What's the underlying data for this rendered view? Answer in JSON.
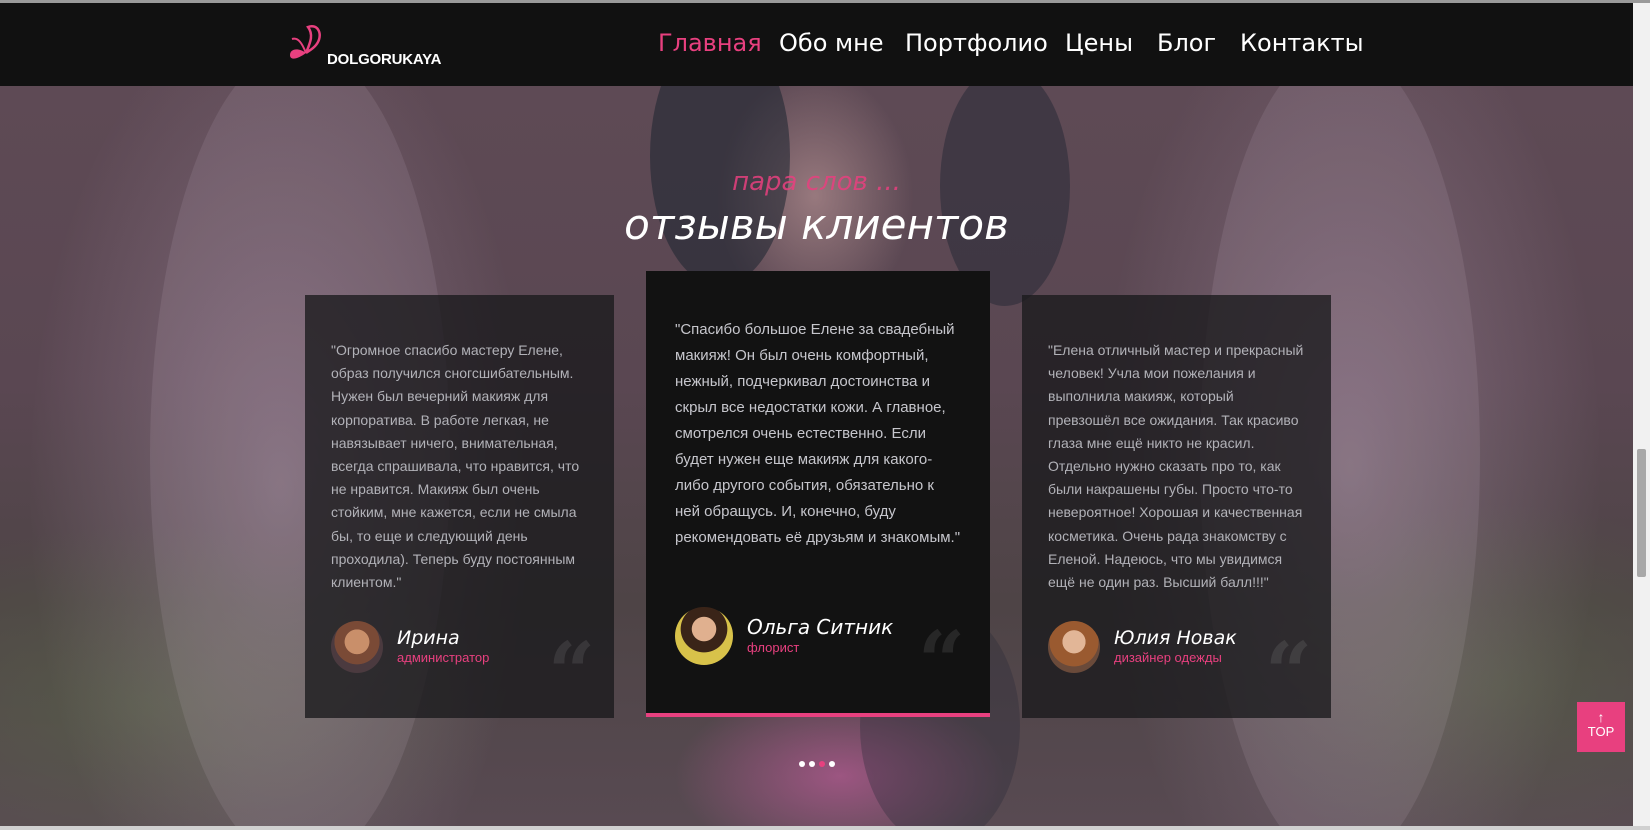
{
  "brand": {
    "name": "DOLGORUKAYA"
  },
  "nav": {
    "items": [
      {
        "label": "Главная",
        "active": true
      },
      {
        "label": "Обо мне",
        "active": false
      },
      {
        "label": "Портфолио",
        "active": false
      },
      {
        "label": "Цены",
        "active": false
      },
      {
        "label": "Блог",
        "active": false
      },
      {
        "label": "Контакты",
        "active": false
      }
    ]
  },
  "section": {
    "pretitle": "пара слов ...",
    "title": "отзывы клиентов"
  },
  "testimonials": [
    {
      "text": "\"Огромное спасибо мастеру Елене, образ получился сногсшибательным. Нужен был вечерний макияж для корпоратива. В работе легкая, не навязывает ничего, внимательная, всегда спрашивала, что нравится, что не нравится. Макияж был очень стойким, мне кажется, если не смыла бы, то еще и следующий день проходила). Теперь буду постоянным клиентом.\"",
      "name": "Ирина",
      "role": "администратор"
    },
    {
      "text": "\"Спасибо большое Елене за свадебный макияж! Он был очень комфортный, нежный, подчеркивал достоинства и скрыл все недостатки кожи. А главное, смотрелся очень естественно. Если будет нужен еще макияж для какого-либо другого события, обязательно к ней обращусь. И, конечно, буду рекомендовать её друзьям и знакомым.\"",
      "name": "Ольга Ситник",
      "role": "флорист"
    },
    {
      "text": "\"Елена отличный мастер и прекрасный человек! Учла мои пожелания и выполнила макияж, который превзошёл все ожидания. Так красиво глаза мне ещё никто не красил. Отдельно нужно сказать про то, как были накрашены губы. Просто что-то невероятное! Хорошая и качественная косметика. Очень рада знакомству с Еленой. Надеюсь, что мы увидимся ещё не один раз. Высший балл!!!\"",
      "name": "Юлия Новак",
      "role": "дизайнер одежды"
    }
  ],
  "quote_glyph": "“",
  "carousel": {
    "count": 4,
    "active_index": 2
  },
  "top_button": {
    "label": "TOP",
    "arrow": "↑"
  },
  "colors": {
    "accent": "#e8407f",
    "header_bg": "#111111",
    "card_bg": "#19191c"
  }
}
